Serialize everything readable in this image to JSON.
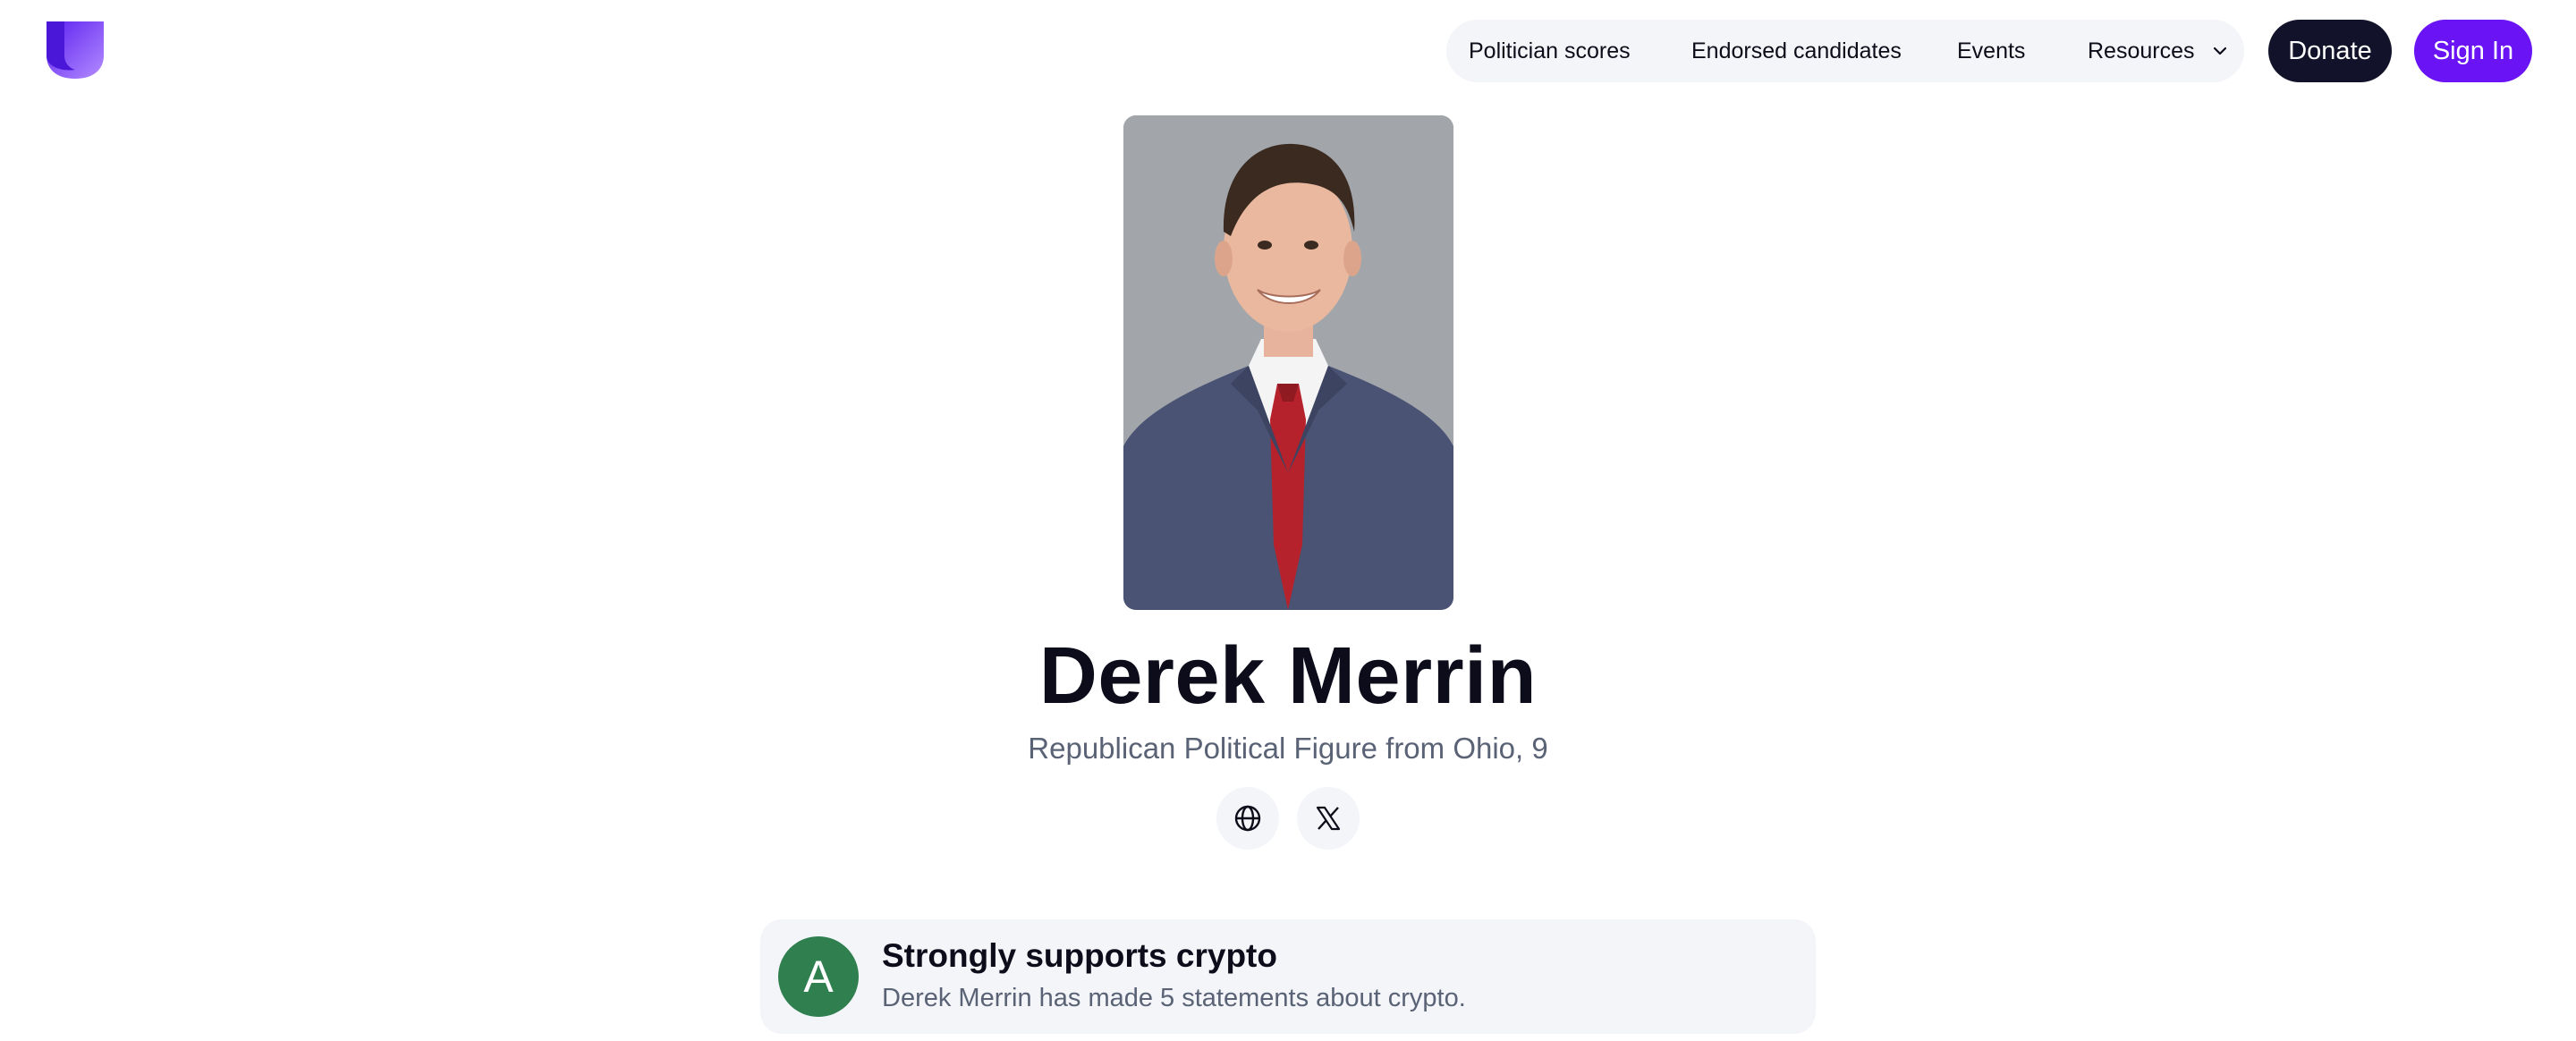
{
  "header": {
    "logo_name": "shield-logo",
    "nav": [
      {
        "label": "Politician scores"
      },
      {
        "label": "Endorsed candidates"
      },
      {
        "label": "Events"
      },
      {
        "label": "Resources",
        "icon": "chevron-down-icon"
      }
    ],
    "donate_label": "Donate",
    "signin_label": "Sign In"
  },
  "profile": {
    "name": "Derek Merrin",
    "subtitle": "Republican Political Figure from Ohio, 9",
    "links": [
      {
        "icon": "globe-icon"
      },
      {
        "icon": "x-logo-icon"
      }
    ]
  },
  "stance": {
    "grade": "A",
    "title": "Strongly supports crypto",
    "description": "Derek Merrin has made 5 statements about crypto."
  },
  "colors": {
    "brand_purple": "#6a13f5",
    "dark": "#12122a",
    "grade_green": "#2f7f4f",
    "pill_bg": "#f3f5f9"
  }
}
